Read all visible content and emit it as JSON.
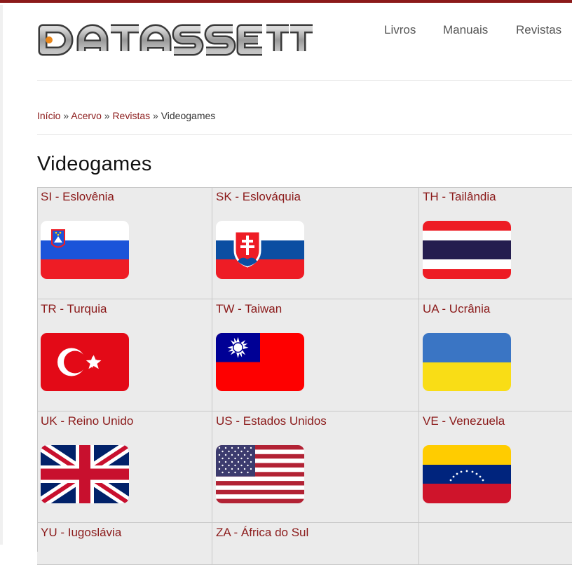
{
  "site": {
    "logo_text": "DATASSETTE"
  },
  "nav": {
    "items": [
      "Livros",
      "Manuais",
      "Revistas"
    ]
  },
  "breadcrumb": {
    "items": [
      "Início",
      "Acervo",
      "Revistas"
    ],
    "separator": "»",
    "current": "Videogames"
  },
  "page": {
    "title": "Videogames"
  },
  "countries": [
    {
      "code": "SI",
      "name": "Eslovênia",
      "flag": "slovenia-flag-icon"
    },
    {
      "code": "SK",
      "name": "Eslováquia",
      "flag": "slovakia-flag-icon"
    },
    {
      "code": "TH",
      "name": "Tailândia",
      "flag": "thailand-flag-icon"
    },
    {
      "code": "TR",
      "name": "Turquia",
      "flag": "turkey-flag-icon"
    },
    {
      "code": "TW",
      "name": "Taiwan",
      "flag": "taiwan-flag-icon"
    },
    {
      "code": "UA",
      "name": "Ucrânia",
      "flag": "ukraine-flag-icon"
    },
    {
      "code": "UK",
      "name": "Reino Unido",
      "flag": "uk-flag-icon"
    },
    {
      "code": "US",
      "name": "Estados Unidos",
      "flag": "usa-flag-icon"
    },
    {
      "code": "VE",
      "name": "Venezuela",
      "flag": "venezuela-flag-icon"
    },
    {
      "code": "YU",
      "name": "Iugoslávia",
      "flag": "yugoslavia-flag-icon"
    },
    {
      "code": "ZA",
      "name": "África do Sul",
      "flag": "south-africa-flag-icon"
    }
  ],
  "colors": {
    "accent": "#8b1a1a",
    "cell_bg": "#ebebeb"
  }
}
